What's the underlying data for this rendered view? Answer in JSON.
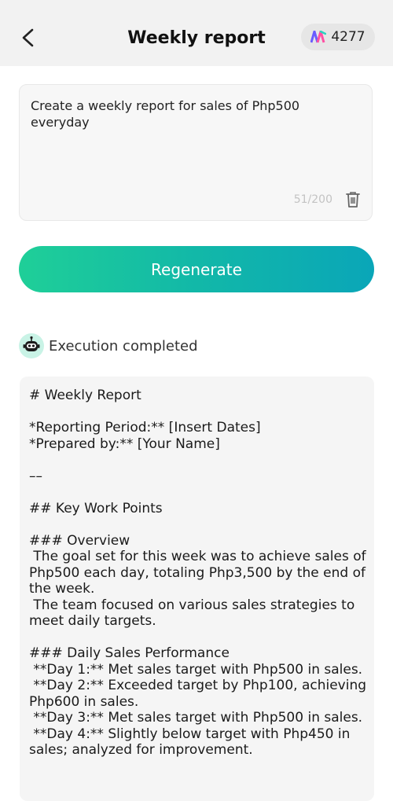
{
  "header": {
    "title": "Weekly report",
    "credits": "4277",
    "back_icon": "chevron-left-icon",
    "credits_icon": "brand-logo-icon"
  },
  "prompt": {
    "text": "Create a weekly report for sales of Php500 everyday",
    "char_count": "51/200",
    "delete_icon": "trash-icon"
  },
  "actions": {
    "regenerate_label": "Regenerate"
  },
  "status": {
    "text": "Execution completed",
    "avatar_icon": "robot-icon"
  },
  "report": {
    "text": "# Weekly Report\n\n*Reporting Period:** [Insert Dates]\n*Prepared by:** [Your Name]\n\n––\n\n## Key Work Points\n\n### Overview\n The goal set for this week was to achieve sales of Php500 each day, totaling Php3,500 by the end of the week.\n The team focused on various sales strategies to meet daily targets.\n\n### Daily Sales Performance\n **Day 1:** Met sales target with Php500 in sales.\n **Day 2:** Exceeded target by Php100, achieving Php600 in sales.\n **Day 3:** Met sales target with Php500 in sales.\n **Day 4:** Slightly below target with Php450 in sales; analyzed for improvement."
  },
  "colors": {
    "header_bg": "#f2f2f2",
    "accent_start": "#1fcf98",
    "accent_end": "#0aa6b8",
    "panel_bg": "#f5f5f5"
  }
}
